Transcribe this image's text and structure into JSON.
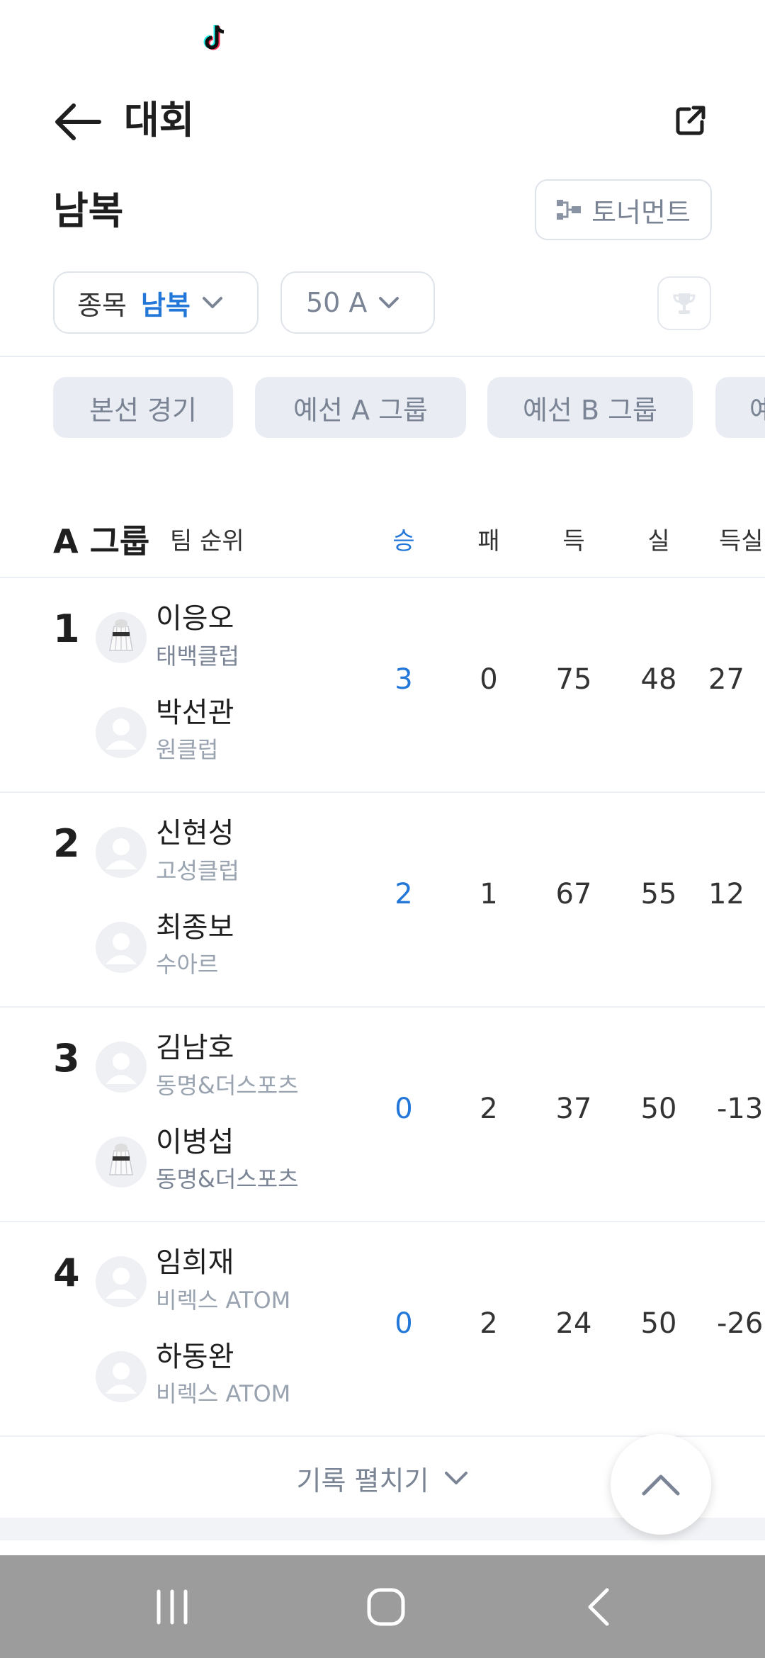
{
  "header": {
    "title": "대회"
  },
  "event": {
    "title": "남복",
    "tournament_label": "토너먼트"
  },
  "filters": {
    "event_key": "종목",
    "event_value": "남복",
    "grade_value": "50 A"
  },
  "stages": [
    "본선 경기",
    "예선 A 그룹",
    "예선 B 그룹",
    "예"
  ],
  "standings": {
    "group_name": "A 그룹",
    "rank_label": "팀 순위",
    "columns": [
      "승",
      "패",
      "득",
      "실",
      "득실"
    ],
    "teams": [
      {
        "rank": "1",
        "players": [
          {
            "name": "이응오",
            "club": "태백클럽"
          },
          {
            "name": "박선관",
            "club": "원클럽"
          }
        ],
        "stats": [
          "3",
          "0",
          "75",
          "48",
          "27"
        ]
      },
      {
        "rank": "2",
        "players": [
          {
            "name": "신현성",
            "club": "고성클럽"
          },
          {
            "name": "최종보",
            "club": "수아르"
          }
        ],
        "stats": [
          "2",
          "1",
          "67",
          "55",
          "12"
        ]
      },
      {
        "rank": "3",
        "players": [
          {
            "name": "김남호",
            "club": "동명&더스포츠"
          },
          {
            "name": "이병섭",
            "club": "동명&더스포츠"
          }
        ],
        "stats": [
          "0",
          "2",
          "37",
          "50",
          "-13"
        ]
      },
      {
        "rank": "4",
        "players": [
          {
            "name": "임희재",
            "club": "비렉스 ATOM"
          },
          {
            "name": "하동완",
            "club": "비렉스 ATOM"
          }
        ],
        "stats": [
          "0",
          "2",
          "24",
          "50",
          "-26"
        ]
      }
    ]
  },
  "expand": {
    "label": "기록 펼치기"
  },
  "icons": {
    "back": "arrow-left-icon",
    "share": "external-link-icon",
    "tournament": "bracket-icon",
    "chevron": "chevron-down-icon",
    "trophy": "trophy-icon",
    "scroll_top": "chevron-up-icon",
    "avatar_default": "person-icon",
    "avatar_shuttle": "shuttlecock-icon"
  },
  "colors": {
    "accent": "#2277d8",
    "muted": "#7a8494",
    "chip_bg": "#e9edf3",
    "nav_bg": "#9c9c9c"
  }
}
